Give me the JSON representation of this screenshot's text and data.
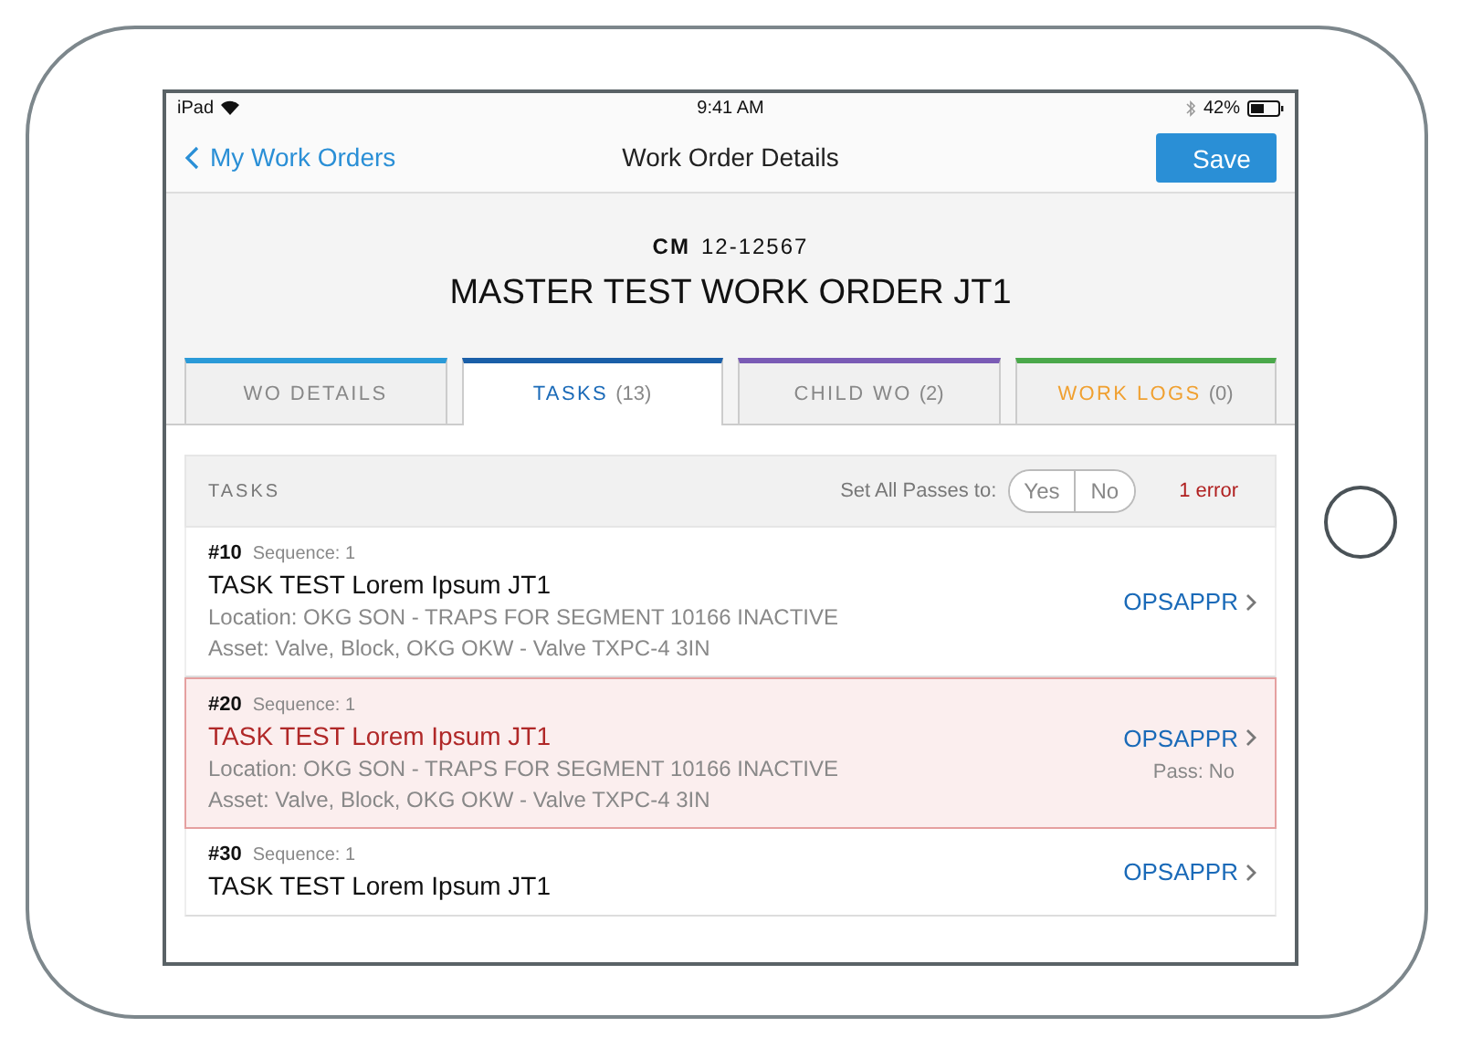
{
  "status_bar": {
    "device": "iPad",
    "time": "9:41 AM",
    "battery": "42%"
  },
  "nav": {
    "back": "My Work Orders",
    "title": "Work Order Details",
    "action": "Save"
  },
  "header": {
    "type": "CM",
    "number": "12-12567",
    "title": "MASTER TEST WORK ORDER JT1"
  },
  "tabs": [
    {
      "label": "WO DETAILS",
      "color": "#2a9ad8",
      "selected": false,
      "highlight": false
    },
    {
      "label": "TASKS",
      "count": "(13)",
      "color": "#1a5fa8",
      "selected": true,
      "highlight": false
    },
    {
      "label": "CHILD WO",
      "count": "(2)",
      "color": "#7a5bb5",
      "selected": false,
      "highlight": false
    },
    {
      "label": "WORK LOGS",
      "count": "(0)",
      "color": "#4aa84a",
      "selected": false,
      "highlight": true
    }
  ],
  "tasks_header": {
    "title": "TASKS",
    "set_all_label": "Set All Passes to:",
    "options": [
      {
        "label": "Yes",
        "selected": false
      },
      {
        "label": "No",
        "selected": false
      }
    ],
    "errors": "1 error"
  },
  "tasks": [
    {
      "number": "#10",
      "sequence": "Sequence: 1",
      "title": "TASK TEST Lorem Ipsum JT1",
      "location": "Location: OKG SON - TRAPS FOR SEGMENT 10166 INACTIVE",
      "asset": "Asset: Valve, Block, OKG OKW - Valve TXPC-4 3IN",
      "status": "OPSAPPR",
      "error": false
    },
    {
      "number": "#20",
      "sequence": "Sequence: 1",
      "title": "TASK TEST Lorem Ipsum JT1",
      "location": "Location: OKG SON - TRAPS FOR SEGMENT 10166 INACTIVE",
      "asset": "Asset: Valve, Block, OKG OKW - Valve TXPC-4 3IN",
      "status": "OPSAPPR",
      "pass": "Pass: No",
      "error": true
    },
    {
      "number": "#30",
      "sequence": "Sequence: 1",
      "title": "TASK TEST Lorem Ipsum JT1",
      "status": "OPSAPPR",
      "error": false
    }
  ]
}
